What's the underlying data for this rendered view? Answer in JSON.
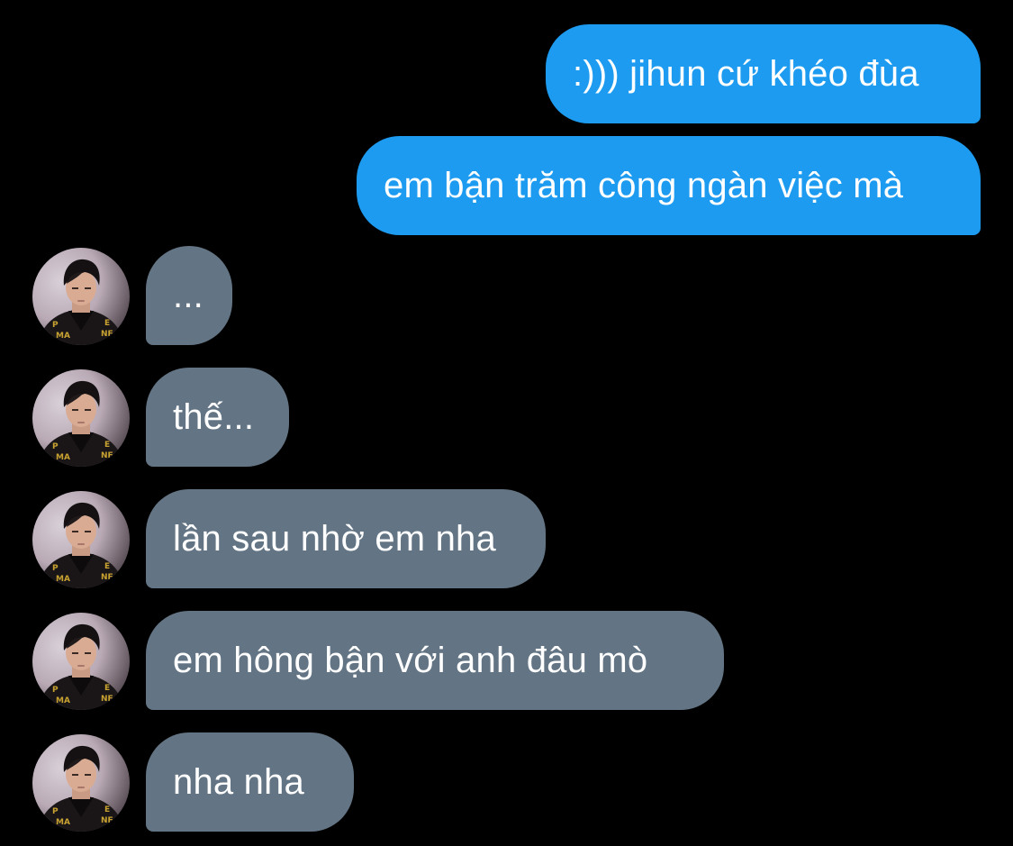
{
  "conversation": {
    "messages": [
      {
        "side": "sent",
        "text": ":))) jihun cứ khéo đùa"
      },
      {
        "side": "sent",
        "text": "em bận trăm công ngàn việc mà"
      },
      {
        "side": "received",
        "text": "..."
      },
      {
        "side": "received",
        "text": "thế..."
      },
      {
        "side": "received",
        "text": "lần sau nhờ em nha"
      },
      {
        "side": "received",
        "text": "em hông bận với anh đâu mò"
      },
      {
        "side": "received",
        "text": "nha nha"
      }
    ]
  },
  "colors": {
    "background": "#000000",
    "sent_bubble": "#1d9bf0",
    "received_bubble": "#637484",
    "text": "#ffffff"
  },
  "icons": {
    "avatar": "profile-photo"
  }
}
